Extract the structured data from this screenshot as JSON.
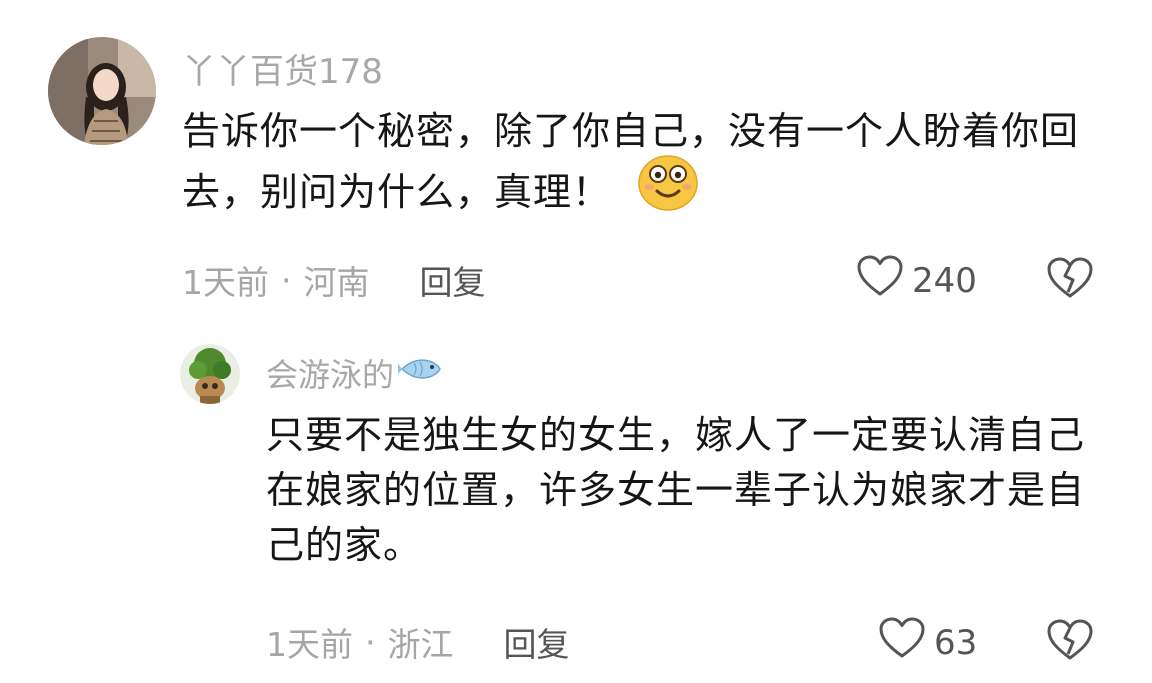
{
  "comments": [
    {
      "username": "丫丫百货178",
      "text": "告诉你一个秘密，除了你自己，没有一个人盼着你回去，别问为什么，真理！",
      "emoji": "smile-emoji",
      "time": "1天前",
      "location": "河南",
      "reply_label": "回复",
      "likes": "240"
    },
    {
      "username": "会游泳的",
      "username_icon": "fish-icon",
      "text": "只要不是独生女的女生，嫁人了一定要认清自己在娘家的位置，许多女生一辈子认为娘家才是自己的家。",
      "time": "1天前",
      "location": "浙江",
      "reply_label": "回复",
      "likes": "63"
    }
  ],
  "colors": {
    "username": "#a8a8a8",
    "text": "#161616",
    "meta": "#a6a6a6",
    "action": "#555555"
  }
}
